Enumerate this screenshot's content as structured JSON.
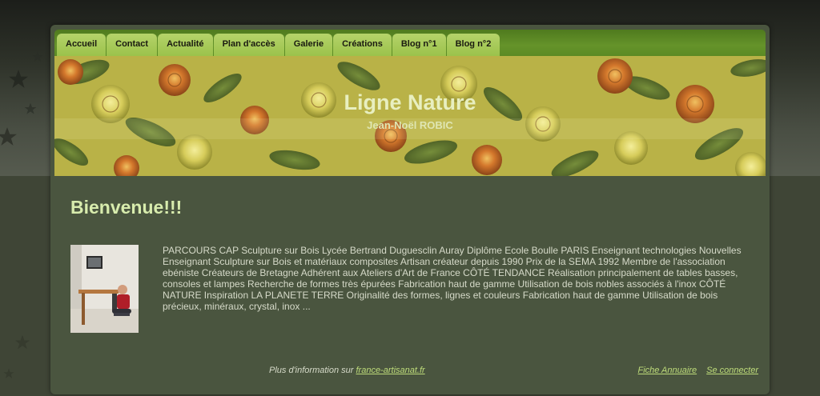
{
  "nav": {
    "items": [
      {
        "label": "Accueil"
      },
      {
        "label": "Contact"
      },
      {
        "label": "Actualité"
      },
      {
        "label": "Plan d'accès"
      },
      {
        "label": "Galerie"
      },
      {
        "label": "Créations"
      },
      {
        "label": "Blog n°1"
      },
      {
        "label": "Blog n°2"
      }
    ]
  },
  "banner": {
    "title": "Ligne Nature",
    "subtitle": "Jean-Noël ROBIC"
  },
  "main": {
    "heading": "Bienvenue!!!",
    "description": "PARCOURS CAP Sculpture sur Bois Lycée Bertrand Duguesclin Auray Diplôme Ecole Boulle PARIS Enseignant technologies Nouvelles Enseignant Sculpture sur Bois et matériaux composites Artisan créateur depuis 1990 Prix de la SEMA 1992 Membre de l'association ebéniste Créateurs de Bretagne Adhérent aux Ateliers d'Art de France CÔTÉ TENDANCE Réalisation principalement de tables basses, consoles et lampes Recherche de formes très épurées Fabrication haut de gamme Utilisation de bois nobles associés à l'inox CÔTÉ NATURE Inspiration LA PLANETE TERRE Originalité des formes, lignes et couleurs Fabrication haut de gamme Utilisation de bois précieux, minéraux, crystal, inox ..."
  },
  "footer": {
    "info_prefix": "Plus d'information sur",
    "info_link": "france-artisanat.fr",
    "fiche_link": "Fiche Annuaire",
    "login_link": "Se connecter"
  },
  "colors": {
    "nav_green": "#65932a",
    "tab_green": "#9bc24b",
    "content_bg": "#4a553f",
    "heading": "#d8ecad",
    "link": "#bedc7a"
  }
}
